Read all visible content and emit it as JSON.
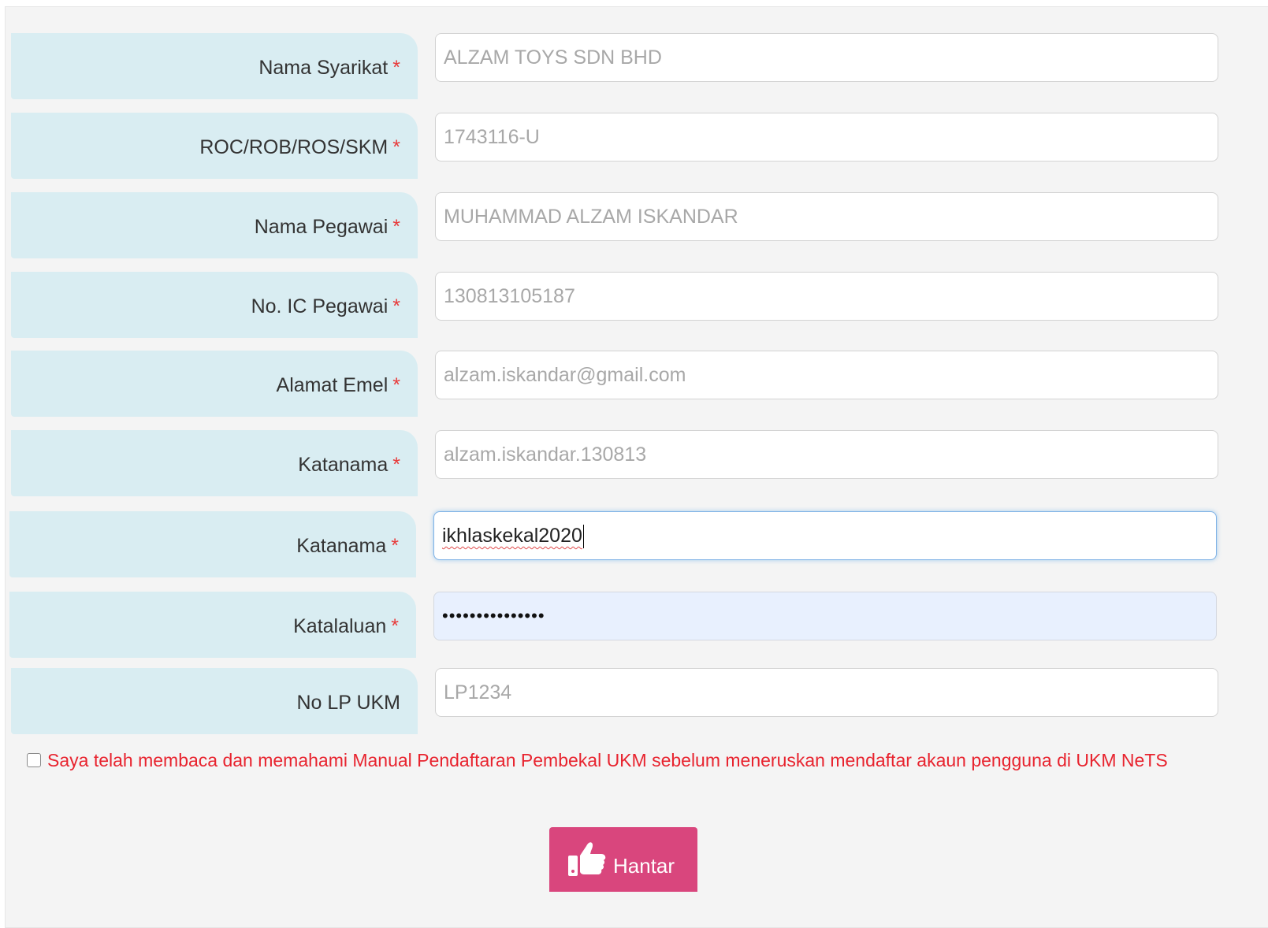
{
  "form": {
    "fields": [
      {
        "label": "Nama Syarikat",
        "required_mark": "*",
        "value": "ALZAM TOYS SDN BHD"
      },
      {
        "label": "ROC/ROB/ROS/SKM",
        "required_mark": "*",
        "value": "1743116-U"
      },
      {
        "label": "Nama Pegawai",
        "required_mark": "*",
        "value": "MUHAMMAD ALZAM ISKANDAR"
      },
      {
        "label": "No. IC Pegawai",
        "required_mark": "*",
        "value": "130813105187"
      },
      {
        "label": "Alamat Emel",
        "required_mark": "*",
        "value": "alzam.iskandar@gmail.com"
      },
      {
        "label": "Katanama",
        "required_mark": "*",
        "value": "alzam.iskandar.130813"
      },
      {
        "label": "Katanama",
        "required_mark": "*",
        "value": "ikhlaskekal2020"
      },
      {
        "label": "Katalaluan",
        "required_mark": "*",
        "value": "•••••••••••••••"
      },
      {
        "label": "No LP UKM",
        "value": "LP1234"
      }
    ],
    "agreement_text": "Saya telah membaca dan memahami Manual Pendaftaran Pembekal UKM sebelum meneruskan mendaftar akaun pengguna di UKM NeTS",
    "agreement_checked": false,
    "submit_label": "Hantar",
    "submit_icon": "thumbs-up-icon"
  },
  "colors": {
    "label_bg": "#d9edf2",
    "required": "#e83a3a",
    "agreement_text": "#e8232e",
    "submit_bg": "#d9467d",
    "autofill_bg": "#e8f0fe"
  }
}
